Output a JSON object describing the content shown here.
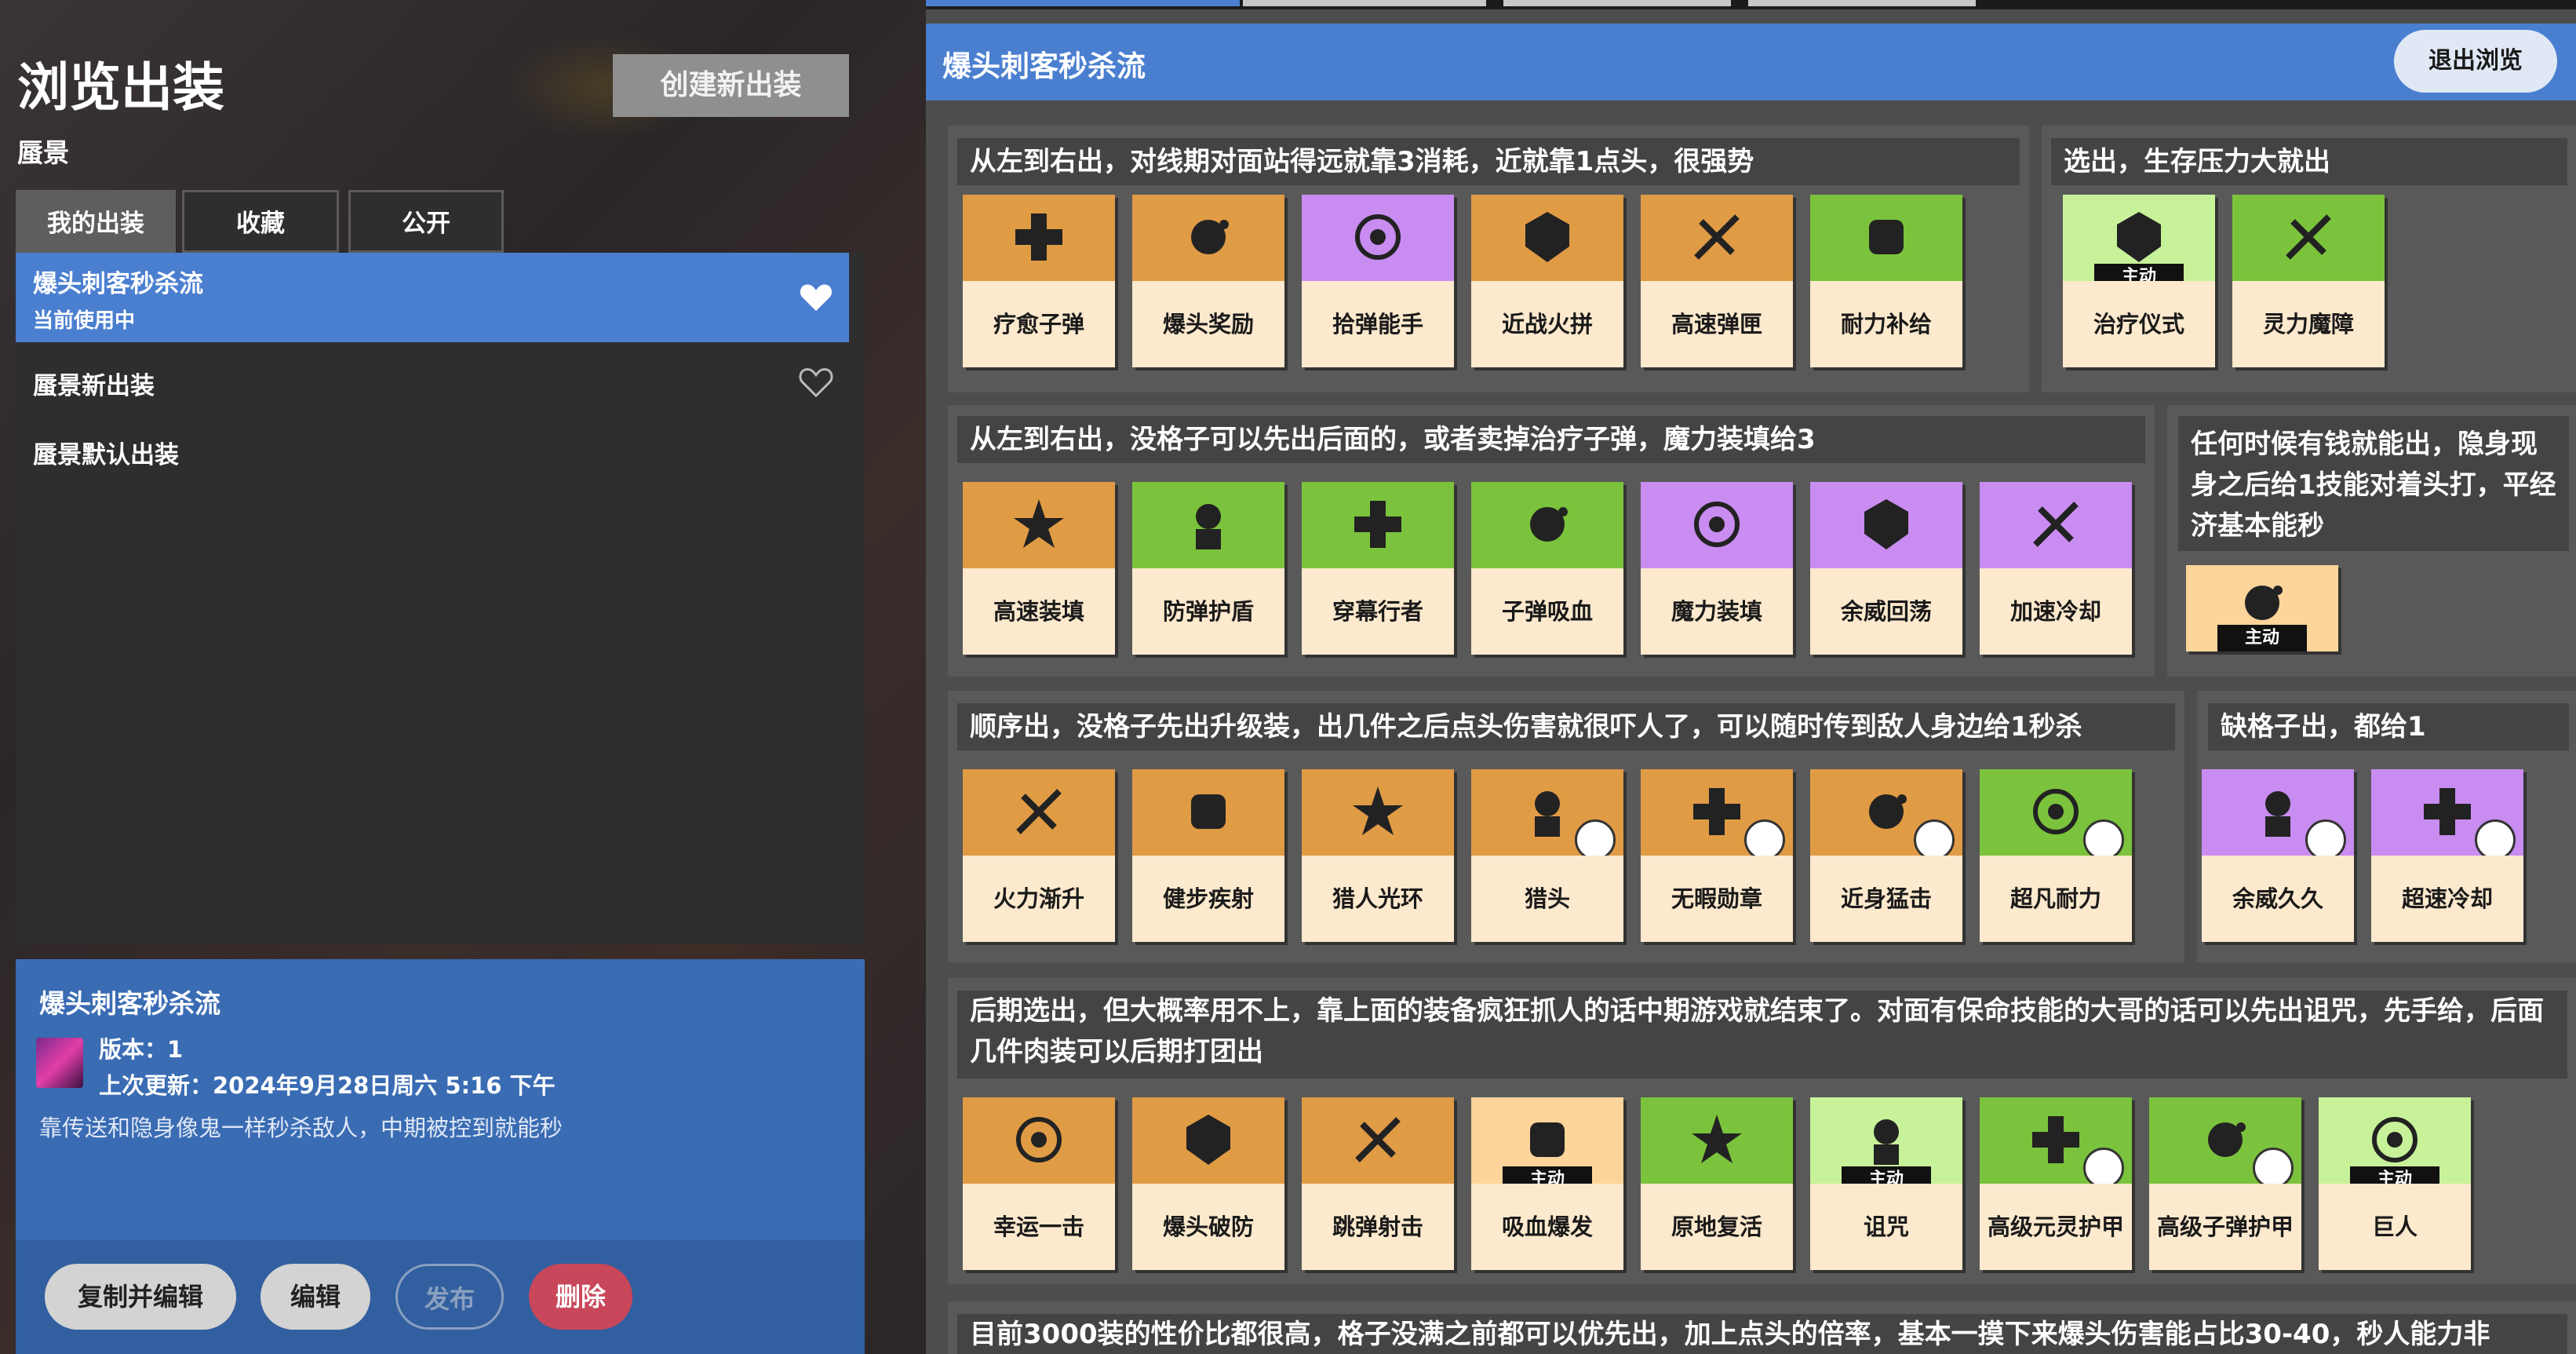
{
  "left": {
    "title": "浏览出装",
    "hero": "蜃景",
    "new_build": "创建新出装",
    "tabs": [
      "我的出装",
      "收藏",
      "公开"
    ],
    "list": [
      {
        "name": "爆头刺客秒杀流",
        "status": "当前使用中"
      },
      {
        "name": "蜃景新出装"
      },
      {
        "name": "蜃景默认出装"
      }
    ],
    "detail": {
      "name": "爆头刺客秒杀流",
      "version": "版本：1",
      "updated": "上次更新：2024年9月28日周六 5:16 下午",
      "description": "靠传送和隐身像鬼一样秒杀敌人，中期被控到就能秒"
    },
    "buttons": {
      "copy_edit": "复制并编辑",
      "edit": "编辑",
      "publish": "发布",
      "delete": "删除"
    }
  },
  "right": {
    "build_title": "爆头刺客秒杀流",
    "exit": "退出浏览",
    "active_label": "主动",
    "groups": [
      {
        "title": "从左到右出，对线期对面站得远就靠3消耗，近就靠1点头，很强势",
        "items": [
          {
            "name": "疗愈子弹",
            "color": "O"
          },
          {
            "name": "爆头奖励",
            "color": "O"
          },
          {
            "name": "拾弹能手",
            "color": "P"
          },
          {
            "name": "近战火拼",
            "color": "O"
          },
          {
            "name": "高速弹匣",
            "color": "O"
          },
          {
            "name": "耐力补给",
            "color": "G"
          }
        ]
      },
      {
        "title": "选出，生存压力大就出",
        "items": [
          {
            "name": "治疗仪式",
            "color": "LG",
            "active": true
          },
          {
            "name": "灵力魔障",
            "color": "G"
          }
        ]
      },
      {
        "title": "从左到右出，没格子可以先出后面的，或者卖掉治疗子弹，魔力装填给3",
        "items": [
          {
            "name": "高速装填",
            "color": "O"
          },
          {
            "name": "防弹护盾",
            "color": "G"
          },
          {
            "name": "穿幕行者",
            "color": "G"
          },
          {
            "name": "子弹吸血",
            "color": "G"
          },
          {
            "name": "魔力装填",
            "color": "P"
          },
          {
            "name": "余威回荡",
            "color": "P"
          },
          {
            "name": "加速冷却",
            "color": "P"
          }
        ]
      },
      {
        "title": "任何时候有钱就能出，隐身现身之后给1技能对着头打，平经济基本能秒",
        "items": [
          {
            "name": "",
            "color": "PO",
            "active": true
          }
        ]
      },
      {
        "title": "顺序出，没格子先出升级装，出几件之后点头伤害就很吓人了，可以随时传到敌人身边给1秒杀",
        "items": [
          {
            "name": "火力渐升",
            "color": "O"
          },
          {
            "name": "健步疾射",
            "color": "O"
          },
          {
            "name": "猎人光环",
            "color": "O"
          },
          {
            "name": "猎头",
            "color": "O"
          },
          {
            "name": "无暇勋章",
            "color": "O"
          },
          {
            "name": "近身猛击",
            "color": "O"
          },
          {
            "name": "超凡耐力",
            "color": "G"
          }
        ]
      },
      {
        "title": "缺格子出，都给1",
        "items": [
          {
            "name": "余威久久",
            "color": "P"
          },
          {
            "name": "超速冷却",
            "color": "P"
          }
        ]
      },
      {
        "title": "后期选出，但大概率用不上，靠上面的装备疯狂抓人的话中期游戏就结束了。对面有保命技能的大哥的话可以先出诅咒，先手给，后面几件肉装可以后期打团出",
        "items": [
          {
            "name": "幸运一击",
            "color": "O"
          },
          {
            "name": "爆头破防",
            "color": "O"
          },
          {
            "name": "跳弹射击",
            "color": "O"
          },
          {
            "name": "吸血爆发",
            "color": "PO",
            "active": true
          },
          {
            "name": "原地复活",
            "color": "G"
          },
          {
            "name": "诅咒",
            "color": "LG",
            "active": true
          },
          {
            "name": "高级元灵护甲",
            "color": "G"
          },
          {
            "name": "高级子弹护甲",
            "color": "G"
          },
          {
            "name": "巨人",
            "color": "LG",
            "active": true
          }
        ]
      },
      {
        "title": "目前3000装的性价比都很高，格子没满之前都可以优先出，加上点头的倍率，基本一摸下来爆头伤害能占比30-40，秒人能力非"
      }
    ]
  },
  "colors": {
    "accent": "#4a7fd0",
    "orange": "#e09b45",
    "green": "#7bc33c",
    "purple": "#c98cf0",
    "light_green": "#c8f29a",
    "pale_orange": "#fdd49a",
    "card_bottom": "#fde9cd",
    "delete": "#c8475a"
  }
}
